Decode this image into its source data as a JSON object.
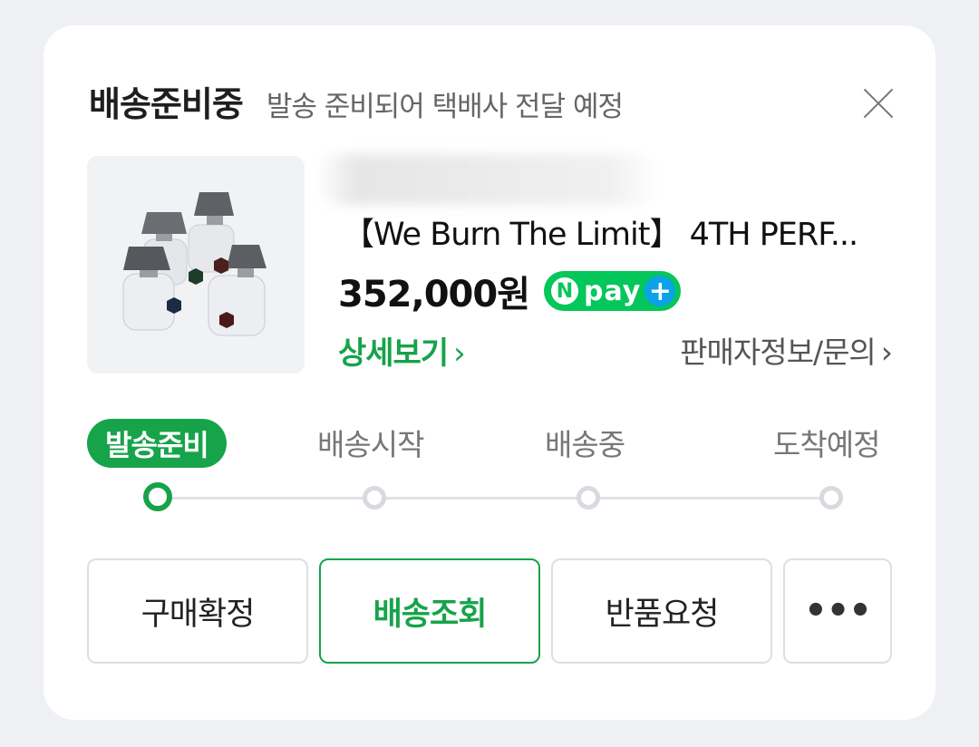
{
  "header": {
    "title": "배송준비중",
    "description": "발송 준비되어 택배사 전달 예정"
  },
  "product": {
    "name": "【We Burn The Limit】 4TH PERF...",
    "price": "352,000원",
    "npay_badge": {
      "n": "N",
      "pay": "pay",
      "plus": "+"
    },
    "detail_link": "상세보기",
    "seller_link": "판매자정보/문의",
    "chevron": "›"
  },
  "progress": {
    "steps": [
      "발송준비",
      "배송시작",
      "배송중",
      "도착예정"
    ],
    "active_index": 0
  },
  "actions": {
    "confirm": "구매확정",
    "track": "배송조회",
    "return": "반품요청",
    "more": "•••"
  },
  "colors": {
    "accent": "#17a34a",
    "npay_green": "#03c75a",
    "npay_plus": "#0aa2e8"
  }
}
